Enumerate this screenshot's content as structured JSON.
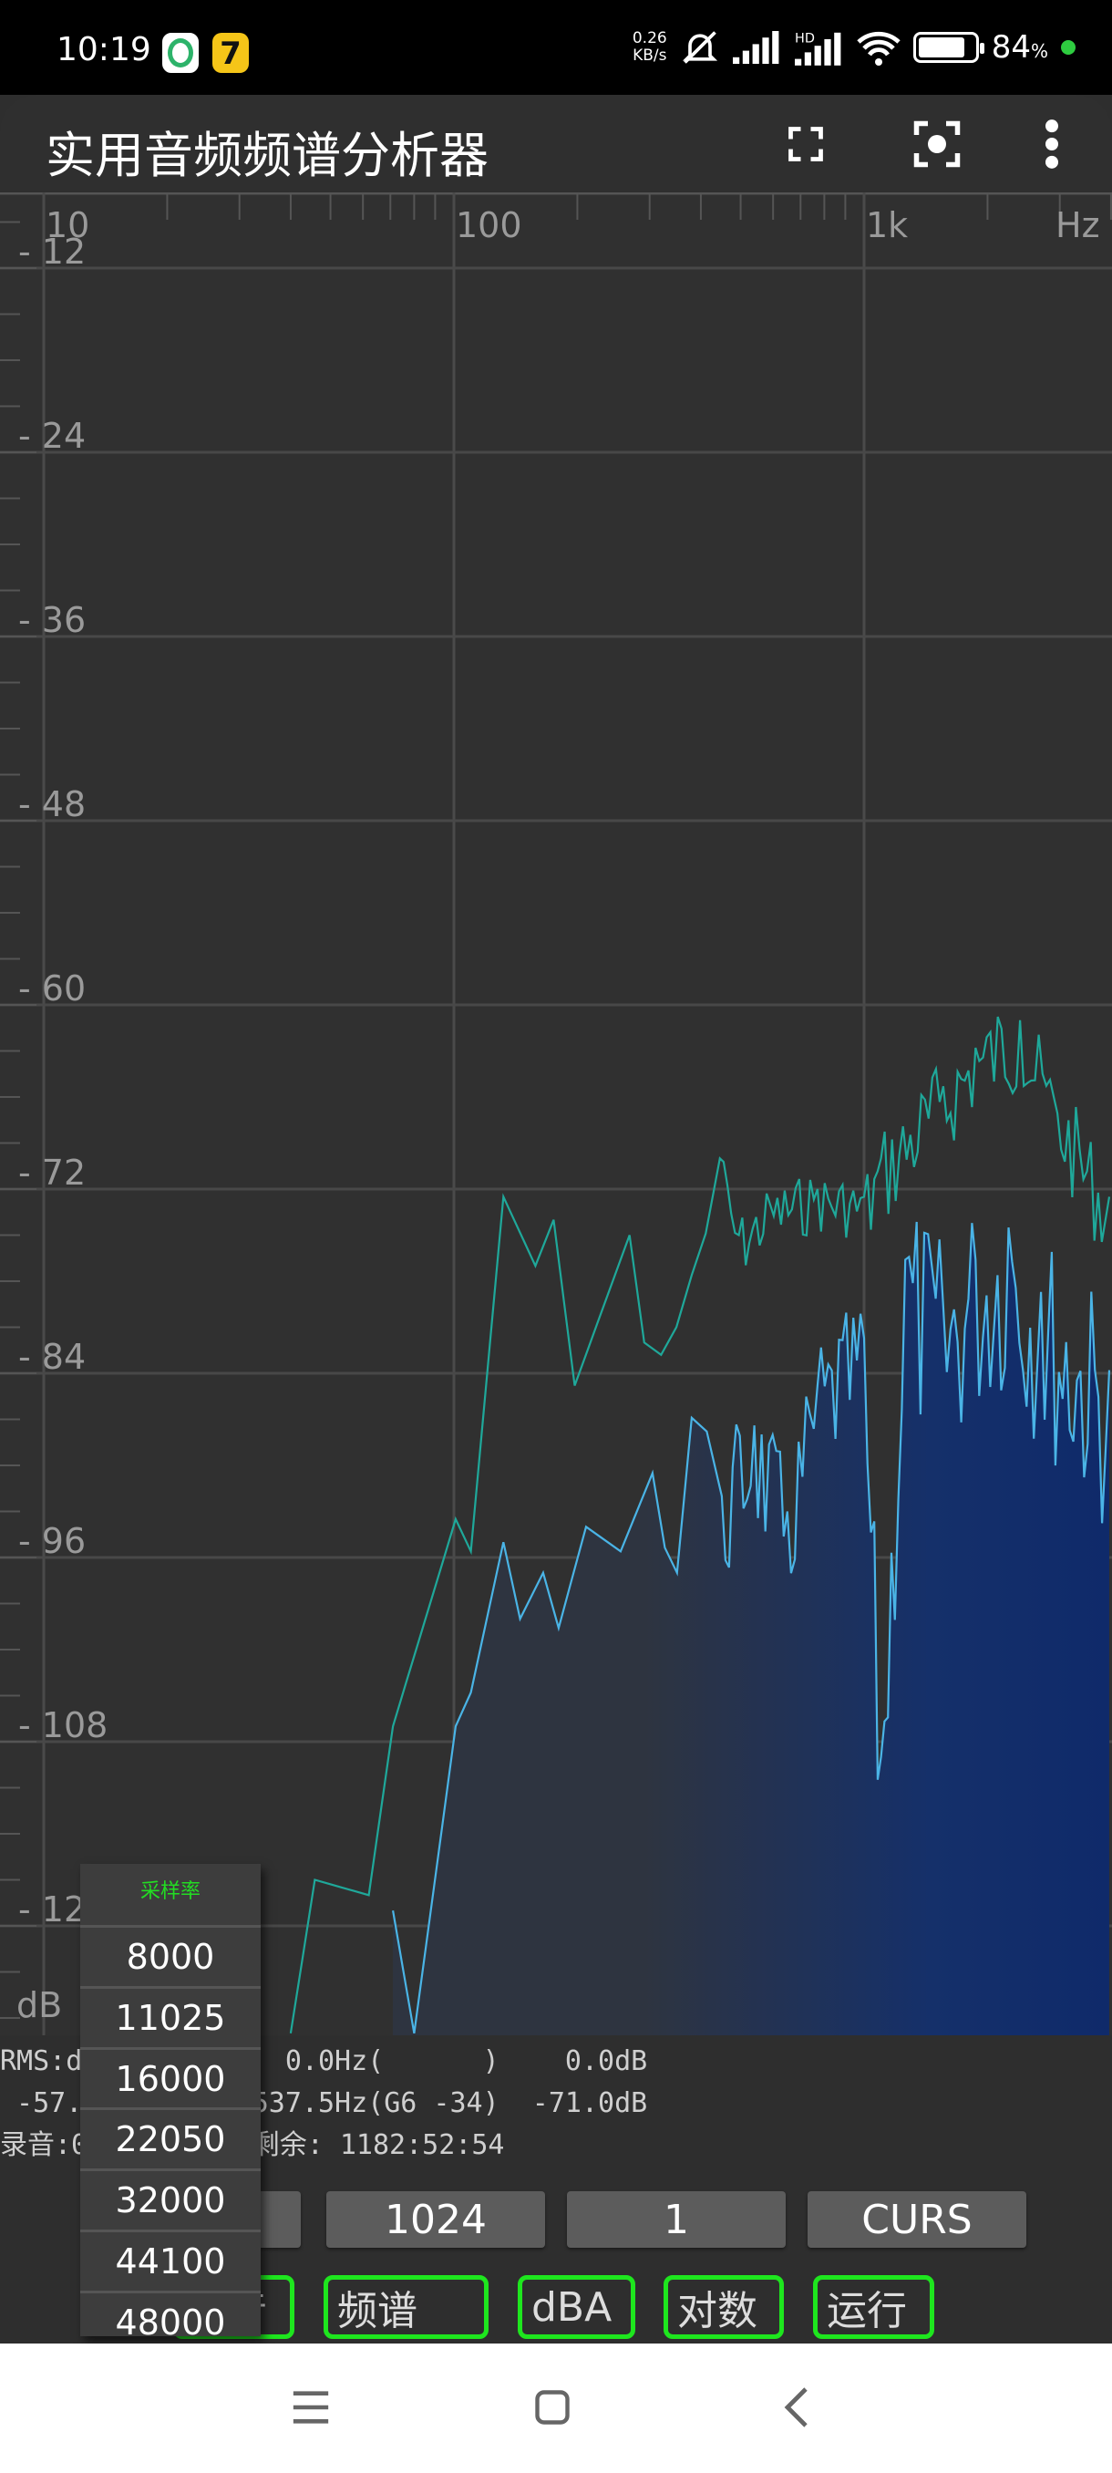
{
  "status_bar": {
    "time": "10:19",
    "net_speed_value": "0.26",
    "net_speed_unit": "KB/s",
    "battery": "84",
    "battery_unit": "%",
    "battery_level_percent": 84,
    "icons": [
      "bell-muted-icon",
      "signal-icon",
      "hd-signal-icon",
      "wifi-icon",
      "battery-icon"
    ]
  },
  "app_bar": {
    "title": "实用音频频谱分析器",
    "actions": [
      "fullscreen-icon",
      "screenshot-icon",
      "more-vert-icon"
    ]
  },
  "chart_data": {
    "type": "line",
    "x_scale": "log",
    "x_unit": "Hz",
    "x_ticks": [
      "10",
      "100",
      "1k"
    ],
    "x_unit_label": "Hz",
    "xlim": [
      7.7,
      4000
    ],
    "y_unit_label": "dB",
    "y_ticks": [
      "-12",
      "-24",
      "-36",
      "-48",
      "-60",
      "-72",
      "-84",
      "-96",
      "-108",
      "-120"
    ],
    "ylim": [
      -130,
      -3
    ],
    "grid": true,
    "series": [
      {
        "role": "peak-hold",
        "color": "#1fa89a",
        "points": [
          [
            40,
            -127
          ],
          [
            45.8,
            -117
          ],
          [
            62,
            -118
          ],
          [
            71,
            -107
          ],
          [
            101,
            -93.5
          ],
          [
            110,
            -95.6
          ],
          [
            132,
            -72.5
          ],
          [
            158,
            -77
          ],
          [
            175,
            -74
          ],
          [
            197,
            -84.8
          ],
          [
            224,
            -80.7
          ],
          [
            268,
            -75
          ],
          [
            291,
            -82
          ],
          [
            320,
            -82.8
          ],
          [
            380,
            -77.6
          ],
          [
            445,
            -70
          ],
          [
            495,
            -75
          ],
          [
            590,
            -73
          ],
          [
            770,
            -72
          ],
          [
            1000,
            -72.5
          ],
          [
            1100,
            -70
          ],
          [
            1560,
            -65.3
          ],
          [
            1870,
            -62.8
          ],
          [
            2400,
            -61
          ],
          [
            2900,
            -66
          ],
          [
            3960,
            -72.5
          ]
        ]
      },
      {
        "role": "current",
        "color": "#4ab4e6",
        "fill_color": "#0f2a6a",
        "points": [
          [
            71,
            -119
          ],
          [
            80,
            -127
          ],
          [
            101,
            -107
          ],
          [
            110,
            -104.8
          ],
          [
            132,
            -95
          ],
          [
            145,
            -100
          ],
          [
            165,
            -97
          ],
          [
            180,
            -100.6
          ],
          [
            210,
            -94
          ],
          [
            255,
            -95.6
          ],
          [
            305,
            -90.5
          ],
          [
            350,
            -97
          ],
          [
            380,
            -86.9
          ],
          [
            450,
            -92
          ],
          [
            540,
            -87.4
          ],
          [
            650,
            -93
          ],
          [
            770,
            -84.8
          ],
          [
            1000,
            -81.7
          ],
          [
            1100,
            -109
          ],
          [
            1260,
            -76.6
          ],
          [
            1560,
            -79.7
          ],
          [
            1870,
            -76.6
          ],
          [
            2250,
            -74.5
          ],
          [
            2700,
            -78.7
          ],
          [
            3960,
            -83.8
          ]
        ]
      }
    ]
  },
  "info": {
    "line1": "RMS:dB   指针:    0.0Hz(      )    0.0dB",
    "line2": " -57.5   峰值: 1537.5Hz(G6 -34)  -71.0dB",
    "line3": "录音:0:00:09.5, 剩余: 1182:52:54"
  },
  "buttons": [
    "8000",
    "1024",
    "1",
    "CURS"
  ],
  "toggles": [
    "录音",
    "频谱",
    "dBA",
    "对数",
    "运行"
  ],
  "toggle_color": "#1ee61e",
  "popup": {
    "title": "采样率",
    "options": [
      "8000",
      "11025",
      "16000",
      "22050",
      "32000",
      "44100",
      "48000"
    ]
  },
  "nav": [
    "menu-icon",
    "home-icon",
    "back-icon"
  ]
}
